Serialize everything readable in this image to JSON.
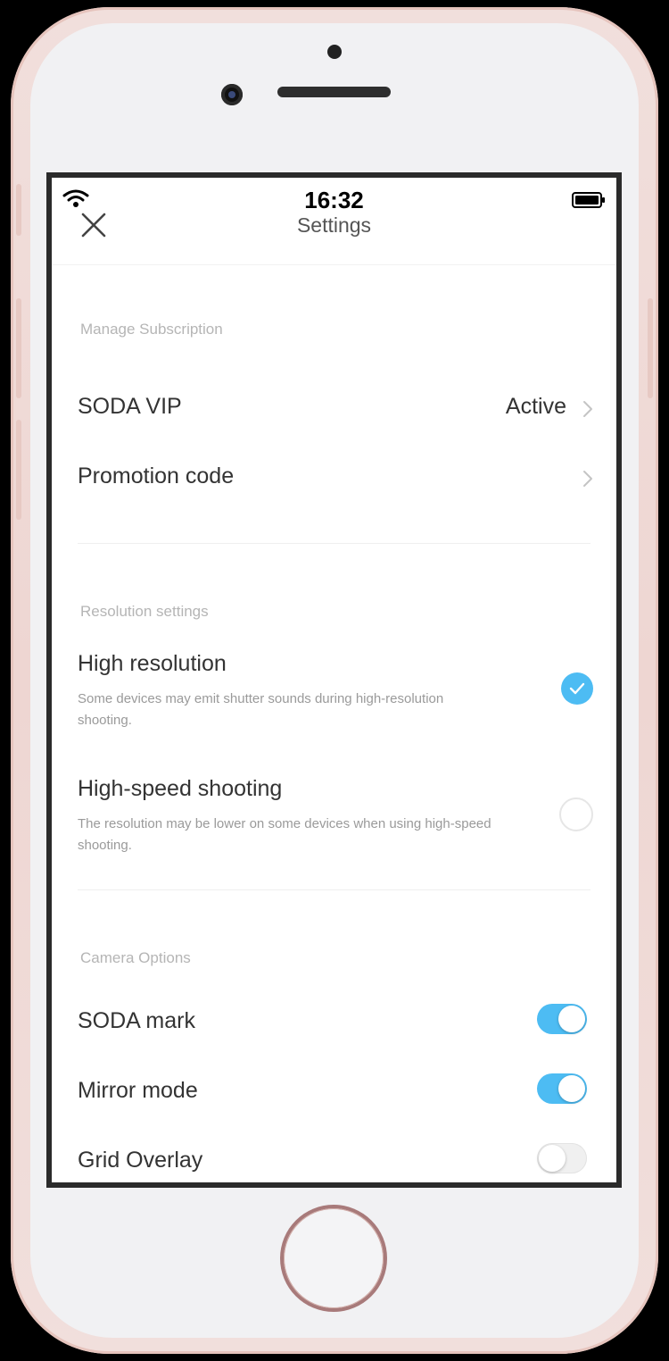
{
  "status_bar": {
    "time": "16:32"
  },
  "nav": {
    "title": "Settings"
  },
  "sections": {
    "subscription": {
      "header": "Manage Subscription",
      "vip_label": "SODA VIP",
      "vip_value": "Active",
      "promo_label": "Promotion code"
    },
    "resolution": {
      "header": "Resolution settings",
      "options": [
        {
          "label": "High resolution",
          "description": "Some devices may emit shutter sounds during high-resolution shooting.",
          "selected": true
        },
        {
          "label": "High-speed shooting",
          "description": "The resolution may be lower on some devices when using high-speed shooting.",
          "selected": false
        }
      ]
    },
    "camera": {
      "header": "Camera Options",
      "toggles": [
        {
          "label": "SODA mark",
          "on": true
        },
        {
          "label": "Mirror mode",
          "on": true
        },
        {
          "label": "Grid Overlay",
          "on": false
        }
      ]
    }
  },
  "colors": {
    "accent": "#4dbcf3",
    "text": "#333333",
    "section_header": "#b5b5b5",
    "description": "#9a9a9a"
  }
}
